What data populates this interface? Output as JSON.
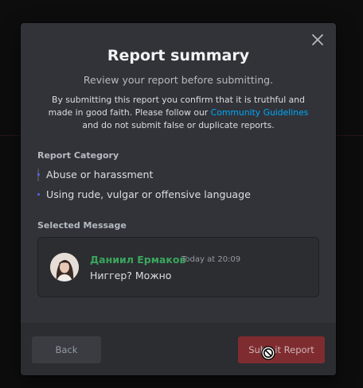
{
  "modal": {
    "title": "Report summary",
    "subtitle": "Review your report before submitting.",
    "disclaimer_before": "By submitting this report you confirm that it is truthful and made in good faith. Please follow our ",
    "disclaimer_link": "Community Guidelines",
    "disclaimer_after": " and do not submit false or duplicate reports.",
    "close_icon": "close-icon"
  },
  "category": {
    "label": "Report Category",
    "items": [
      {
        "label": "Abuse or harassment"
      },
      {
        "label": "Using rude, vulgar or offensive language"
      }
    ]
  },
  "message": {
    "label": "Selected Message",
    "author": "Даниил Ермаков",
    "timestamp": "Today at 20:09",
    "text": "Ниггер? Можно",
    "author_color": "#3ba55d"
  },
  "footer": {
    "back_label": "Back",
    "submit_label": "Submit Report",
    "submit_color": "#7f2c30"
  },
  "colors": {
    "modal_bg": "#313338",
    "link": "#00a8fc",
    "accent": "#5865f2"
  }
}
